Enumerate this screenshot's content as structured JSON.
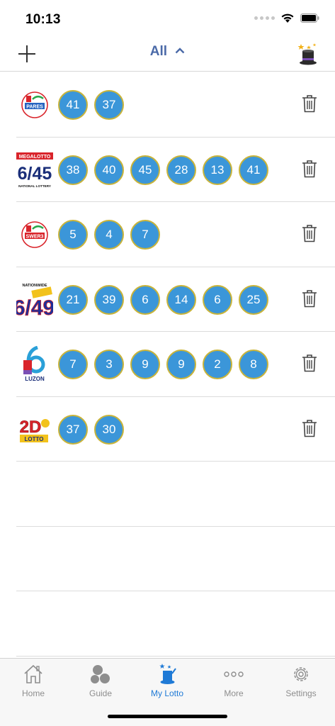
{
  "status": {
    "time": "10:13"
  },
  "nav": {
    "filter_label": "All"
  },
  "rows": [
    {
      "logo": "pares-icon",
      "logo_text": "PARES",
      "numbers": [
        "41",
        "37"
      ]
    },
    {
      "logo": "megalotto-645-icon",
      "logo_top": "MEGALOTTO",
      "logo_main": "6/45",
      "logo_bottom": "NATIONAL LOTTERY",
      "numbers": [
        "38",
        "40",
        "45",
        "28",
        "13",
        "41"
      ]
    },
    {
      "logo": "swer3-icon",
      "logo_text": "SWER3",
      "numbers": [
        "5",
        "4",
        "7"
      ]
    },
    {
      "logo": "superlotto-649-icon",
      "logo_top": "NATIONWIDE",
      "logo_main": "6/49",
      "numbers": [
        "21",
        "39",
        "6",
        "14",
        "6",
        "25"
      ]
    },
    {
      "logo": "6d-luzon-icon",
      "logo_bottom": "LUZON",
      "numbers": [
        "7",
        "3",
        "9",
        "9",
        "2",
        "8"
      ]
    },
    {
      "logo": "2d-lotto-icon",
      "logo_main": "2D",
      "logo_bottom": "LOTTO",
      "numbers": [
        "37",
        "30"
      ]
    }
  ],
  "tabs": [
    {
      "label": "Home",
      "icon": "house-icon"
    },
    {
      "label": "Guide",
      "icon": "balls-icon"
    },
    {
      "label": "My Lotto",
      "icon": "wizard-icon"
    },
    {
      "label": "More",
      "icon": "dots-icon"
    },
    {
      "label": "Settings",
      "icon": "gear-icon"
    }
  ],
  "colors": {
    "ball": "#3b96d9",
    "ball_border": "#c9b43a",
    "accent": "#1f7ad6",
    "title": "#4b6aa8"
  }
}
